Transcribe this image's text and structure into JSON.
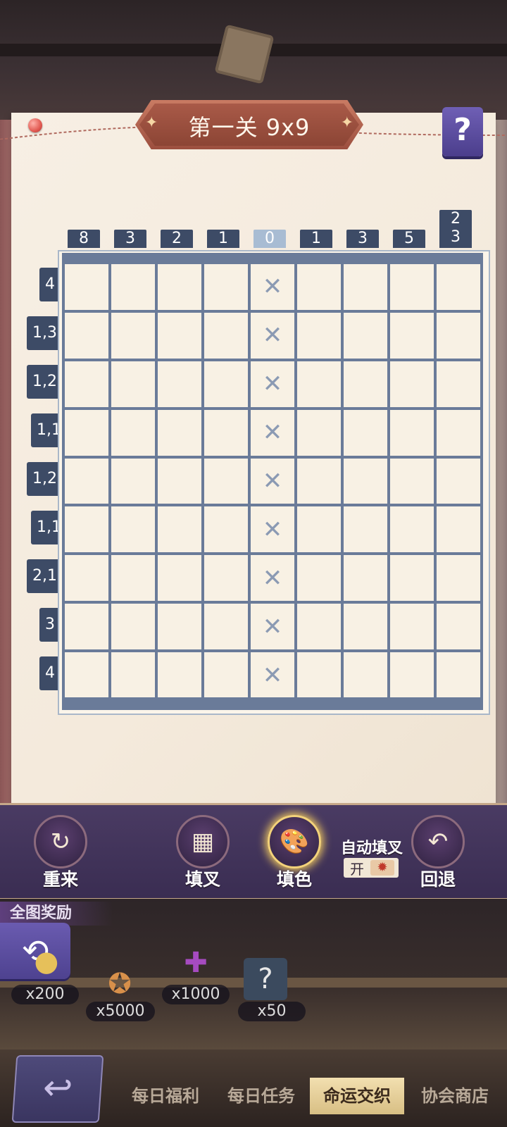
{
  "level": {
    "title": "第一关 9x9"
  },
  "help": {
    "label": "?"
  },
  "col_clues": [
    {
      "top": "",
      "bottom": "8"
    },
    {
      "top": "",
      "bottom": "3"
    },
    {
      "top": "",
      "bottom": "2"
    },
    {
      "top": "",
      "bottom": "1"
    },
    {
      "top": "",
      "bottom": "0"
    },
    {
      "top": "",
      "bottom": "1"
    },
    {
      "top": "",
      "bottom": "3"
    },
    {
      "top": "",
      "bottom": "5"
    },
    {
      "top": "2",
      "bottom": "3"
    }
  ],
  "row_clues": [
    "4",
    "1,3",
    "1,2",
    "1,1",
    "1,2",
    "1,1",
    "2,1",
    "3",
    "4"
  ],
  "grid": {
    "rows": 9,
    "cols": 9,
    "cross_mark": "✕",
    "crossed_column_index": 4
  },
  "toolbar": {
    "restart": {
      "label": "重来",
      "icon": "↻"
    },
    "fill_cross": {
      "label": "填叉",
      "icon": "▦"
    },
    "fill_color": {
      "label": "填色",
      "icon": "🎨"
    },
    "auto_cross": {
      "label": "自动填叉",
      "state": "开",
      "knob": "✹"
    },
    "undo": {
      "label": "回退",
      "icon": "↶"
    }
  },
  "rewards": {
    "title": "全图奖励",
    "flag_icon": "⟲",
    "items": [
      {
        "qty": "x200",
        "icon": "coin-icon"
      },
      {
        "qty": "x5000",
        "icon": "badge-icon"
      },
      {
        "qty": "x1000",
        "icon": "puzzle-icon"
      },
      {
        "qty": "x50",
        "icon": "mystery-card-icon"
      }
    ]
  },
  "nav": {
    "back_icon": "↩",
    "tabs": [
      "每日福利",
      "每日任务",
      "命运交织",
      "协会商店"
    ],
    "active_index": 2
  },
  "colors": {
    "clue_bg": "#3d4b66",
    "clue_active_bg": "#a8bcd3",
    "grid_line": "#6a7b99",
    "cell_bg": "#f8f1e4",
    "accent_gold": "#f0c95f"
  }
}
